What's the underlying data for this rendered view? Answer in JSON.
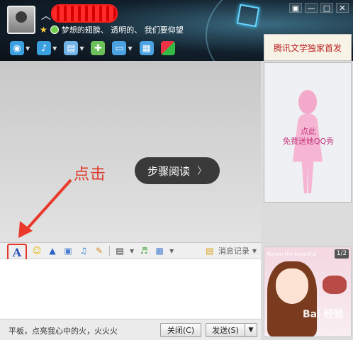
{
  "header": {
    "nickname": "",
    "signature": "梦想的翅膀、 透明的、 我们要仰望",
    "window_buttons": [
      "▣",
      "—",
      "□",
      "✕"
    ]
  },
  "toolbar": {
    "items": [
      {
        "icon": "camera-icon",
        "glyph": "◉",
        "color": "#3aa0e0"
      },
      {
        "icon": "microphone-icon",
        "glyph": "🎤",
        "color": "#3aa0e0"
      },
      {
        "icon": "file-transfer-icon",
        "glyph": "▤",
        "color": "#6fb2e8"
      },
      {
        "icon": "app-icon",
        "glyph": "✚",
        "color": "#6dc15a"
      },
      {
        "icon": "remote-desktop-icon",
        "glyph": "▭",
        "color": "#4aa2e0"
      },
      {
        "icon": "screen-share-icon",
        "glyph": "▦",
        "color": "#4aa2e0"
      },
      {
        "icon": "apps-grid-icon",
        "glyph": "▦",
        "color": "#e08a3a"
      }
    ]
  },
  "annotation": {
    "click_hint": "点击",
    "step_reading": "步骤阅读"
  },
  "right_panel": {
    "banner": "腾讯文学独家首发",
    "show_line1": "点此",
    "show_line2": "免费送她QQ秀"
  },
  "input_toolbar": {
    "font_button": "A",
    "history_label": "消息记录"
  },
  "bottom": {
    "tip": "平板，点亮我心中的火，火火火",
    "close_label": "关闭(C)",
    "send_label": "发送(S)",
    "send_drop": "▼"
  },
  "ad2": {
    "tagline": "Retain the beautiful",
    "page": "1/2",
    "watermark": "Bai 经验"
  }
}
